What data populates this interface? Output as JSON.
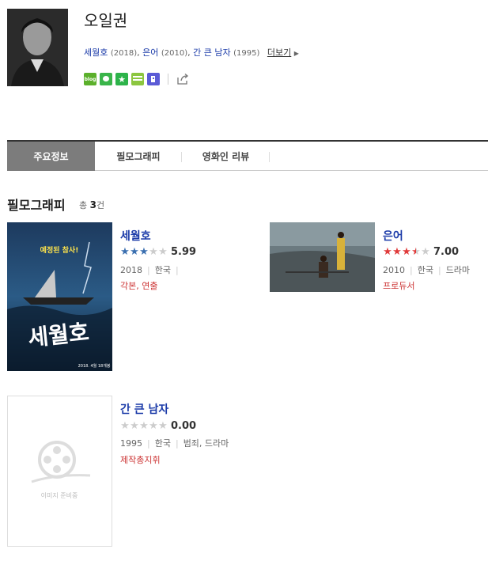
{
  "person": {
    "name": "오일권",
    "works": [
      {
        "title": "세월호",
        "year": "(2018)"
      },
      {
        "title": "은어",
        "year": "(2010)"
      },
      {
        "title": "간 큰 남자",
        "year": "(1995)"
      }
    ],
    "more_label": "더보기",
    "sns": [
      {
        "name": "blog-icon",
        "color": "#5bb02b",
        "label": "blog"
      },
      {
        "name": "talk-icon",
        "color": "#3ab54a",
        "label": ""
      },
      {
        "name": "star-icon",
        "color": "#2db34a",
        "label": "★"
      },
      {
        "name": "list-icon",
        "color": "#8cc63f",
        "label": ""
      },
      {
        "name": "page-icon",
        "color": "#5b5bd6",
        "label": ""
      }
    ]
  },
  "tabs": [
    "주요정보",
    "필모그래피",
    "영화인 리뷰"
  ],
  "filmography": {
    "title": "필모그래피",
    "count_prefix": "총",
    "count": "3",
    "count_suffix": "건",
    "items": [
      {
        "title": "세월호",
        "rating": 2.995,
        "score": "5.99",
        "year": "2018",
        "country": "한국",
        "genre": "",
        "role": "각본, 연출",
        "poster_caption": "예정된 참사!",
        "poster_title": "세월호",
        "poster_date": "2018. 4월 18개봉"
      },
      {
        "title": "은어",
        "rating": 3.5,
        "score": "7.00",
        "year": "2010",
        "country": "한국",
        "genre": "드라마",
        "role": "프로듀서"
      },
      {
        "title": "간 큰 남자",
        "rating": 0,
        "score": "0.00",
        "year": "1995",
        "country": "한국",
        "genre": "범죄, 드라마",
        "role": "제작총지휘",
        "placeholder_label": "이미지 준비중"
      }
    ]
  },
  "colors": {
    "link": "#1a3aa8",
    "role": "#cc3333",
    "star_blue": "#3a6fb0",
    "star_red": "#e03a3a",
    "star_empty": "#cccccc"
  }
}
